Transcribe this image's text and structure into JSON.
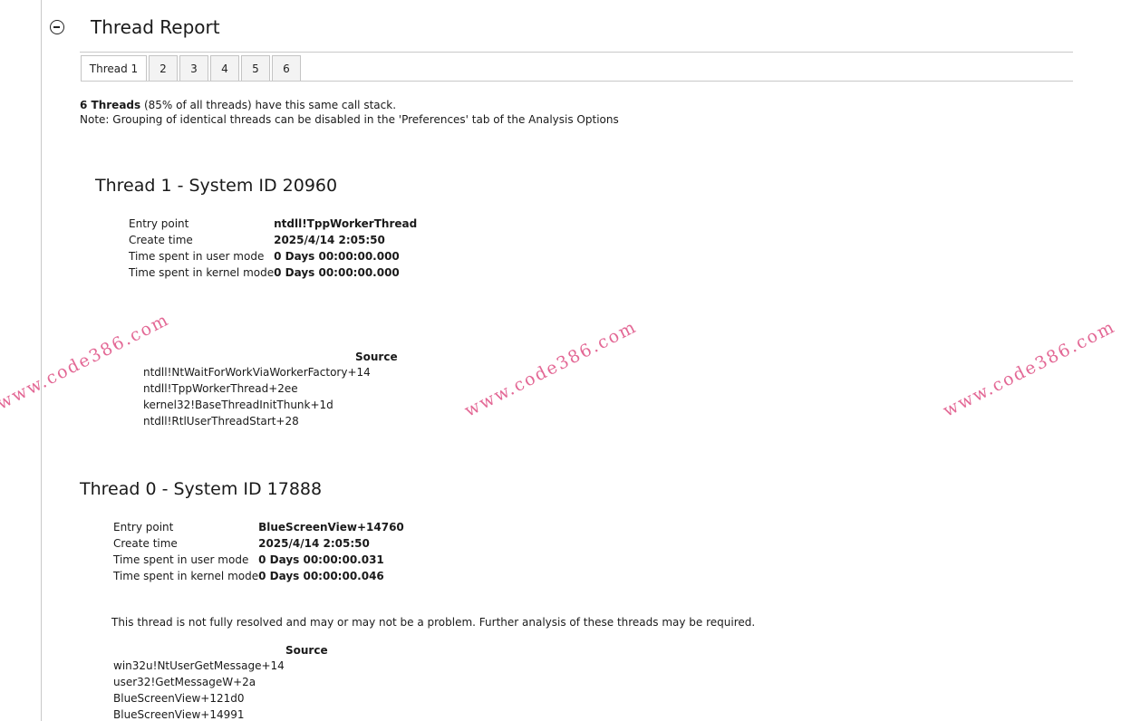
{
  "report": {
    "title": "Thread Report"
  },
  "tabs": [
    {
      "label": "Thread 1",
      "active": true
    },
    {
      "label": "2",
      "active": false
    },
    {
      "label": "3",
      "active": false
    },
    {
      "label": "4",
      "active": false
    },
    {
      "label": "5",
      "active": false
    },
    {
      "label": "6",
      "active": false
    }
  ],
  "summary": {
    "count_bold": "6 Threads",
    "count_rest": " (85% of all threads) have this same call stack.",
    "note": "Note: Grouping of identical threads can be disabled in the 'Preferences' tab of the Analysis Options"
  },
  "threads": [
    {
      "heading": "Thread 1 - System ID 20960",
      "fields": [
        {
          "label": "Entry point",
          "value": "ntdll!TppWorkerThread"
        },
        {
          "label": "Create time",
          "value": "2025/4/14 2:05:50"
        },
        {
          "label": "Time spent in user mode",
          "value": "0 Days 00:00:00.000"
        },
        {
          "label": "Time spent in kernel mode",
          "value": "0 Days 00:00:00.000"
        }
      ],
      "source_header": "Source",
      "frames": [
        "ntdll!NtWaitForWorkViaWorkerFactory+14",
        "ntdll!TppWorkerThread+2ee",
        "kernel32!BaseThreadInitThunk+1d",
        "ntdll!RtlUserThreadStart+28"
      ]
    },
    {
      "heading": "Thread 0 - System ID 17888",
      "fields": [
        {
          "label": "Entry point",
          "value": "BlueScreenView+14760"
        },
        {
          "label": "Create time",
          "value": "2025/4/14 2:05:50"
        },
        {
          "label": "Time spent in user mode",
          "value": "0 Days 00:00:00.031"
        },
        {
          "label": "Time spent in kernel mode",
          "value": "0 Days 00:00:00.046"
        }
      ],
      "note": "This thread is not fully resolved and may or may not be a problem. Further analysis of these threads may be required.",
      "source_header": "Source",
      "frames": [
        "win32u!NtUserGetMessage+14",
        "user32!GetMessageW+2a",
        "BlueScreenView+121d0",
        "BlueScreenView+14991"
      ]
    }
  ],
  "watermarks": [
    "www.code386.com",
    "www.code386.com",
    "www.code386.com"
  ],
  "colors": {
    "watermark": "#e0588a",
    "rule": "#c8c8c8"
  }
}
